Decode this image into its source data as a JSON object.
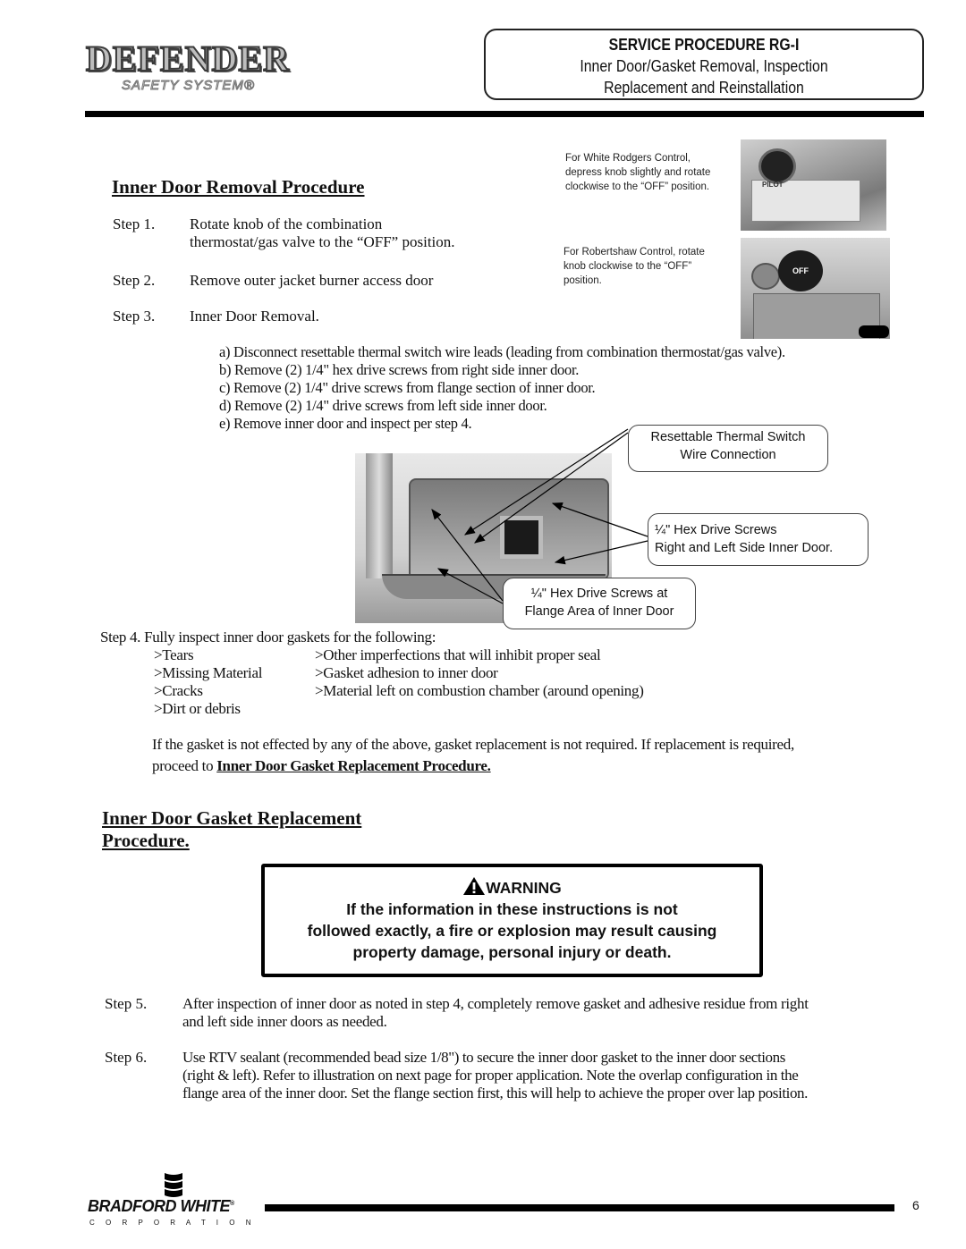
{
  "header": {
    "logo_main": "DEFENDER",
    "logo_sub": "SAFETY SYSTEM®",
    "procedure_title": "SERVICE PROCEDURE RG-I",
    "procedure_subtitle_line1": "Inner Door/Gasket Removal, Inspection",
    "procedure_subtitle_line2": "Replacement and Reinstallation"
  },
  "removal": {
    "heading": "Inner Door Removal Procedure",
    "steps": [
      {
        "label": "Step 1.",
        "text_line1": "Rotate knob of the combination",
        "text_line2": "thermostat/gas valve to the “OFF” position."
      },
      {
        "label": "Step 2.",
        "text_line1": "Remove outer jacket burner access door"
      },
      {
        "label": "Step 3.",
        "text_line1": "Inner Door Removal."
      }
    ],
    "substeps": [
      "a) Disconnect resettable thermal switch wire leads (leading from combination thermostat/gas valve).",
      "b) Remove (2) 1/4\" hex drive screws from right side inner door.",
      "c) Remove (2) 1/4\" drive screws from flange section of inner door.",
      "d) Remove (2) 1/4\" drive screws from left side inner door.",
      "e) Remove inner door and inspect per step 4."
    ]
  },
  "control_captions": {
    "white_rodgers": [
      "For White Rodgers Control,",
      "depress knob slightly and rotate",
      "clockwise to the “OFF” position."
    ],
    "robertshaw": [
      "For Robertshaw Control, rotate",
      "knob clockwise to the “OFF”",
      "position."
    ],
    "knob_labels": {
      "pilot": "PILOT",
      "off": "OFF"
    }
  },
  "callouts": {
    "thermal_switch": [
      "Resettable Thermal Switch",
      "Wire Connection"
    ],
    "side_screws": [
      "¼\" Hex Drive Screws",
      "Right and Left Side Inner Door."
    ],
    "flange_screws": [
      "¼\" Hex Drive Screws at",
      "Flange Area of Inner Door"
    ]
  },
  "inspection": {
    "intro": "Step 4. Fully inspect inner door gaskets for the following:",
    "left_items": [
      ">Tears",
      ">Missing Material",
      ">Cracks",
      ">Dirt or debris"
    ],
    "right_items": [
      ">Other imperfections that will inhibit proper seal",
      ">Gasket adhesion to inner door",
      ">Material left on combustion chamber (around opening)"
    ],
    "note_line1": "If the gasket is not effected by any of the above, gasket replacement is not required. If replacement is required,",
    "note_prefix": "proceed to ",
    "note_link": "Inner Door Gasket Replacement Procedure."
  },
  "replacement": {
    "heading_line1": "Inner Door Gasket Replacement",
    "heading_line2": "Procedure.",
    "warning": {
      "title": "WARNING",
      "line1": "If the information in these instructions is not",
      "line2": "followed exactly, a fire or explosion may result causing",
      "line3": "property damage, personal injury or death."
    },
    "steps": [
      {
        "label": "Step 5.",
        "lines": [
          "After inspection of inner door as noted in step 4, completely remove gasket and adhesive residue from right",
          "and  left side inner doors as needed."
        ]
      },
      {
        "label": "Step 6.",
        "lines": [
          "Use RTV sealant (recommended bead size 1/8\") to secure the inner door gasket to the inner door sections",
          "(right & left). Refer to illustration on next page for proper application. Note the overlap configuration in the",
          "flange area of the inner door. Set the flange section first, this will help to achieve the proper over lap position."
        ]
      }
    ]
  },
  "footer": {
    "brand": "BRADFORD WHITE",
    "brand_mark": "®",
    "corporation": "C O R P O R A T I O N",
    "page_number": "6"
  }
}
